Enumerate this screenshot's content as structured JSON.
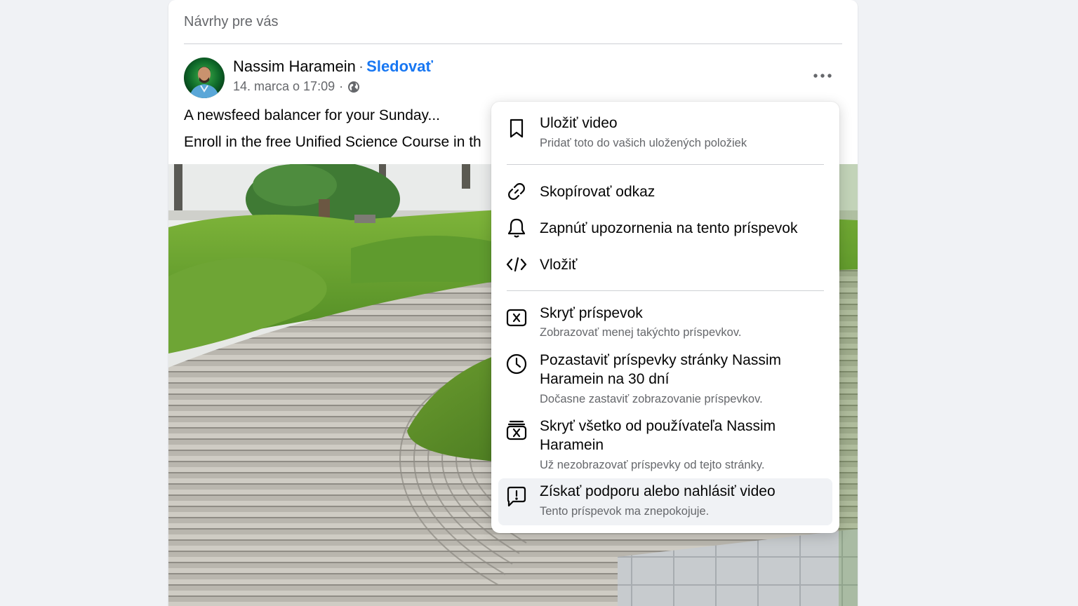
{
  "feed": {
    "section_title": "Návrhy pre vás"
  },
  "post": {
    "author_name": "Nassim Haramein",
    "separator": "·",
    "follow_label": "Sledovať",
    "timestamp": "14. marca o 17:09",
    "meta_separator": "·",
    "privacy_icon": "globe-icon",
    "line1": "A newsfeed balancer for your Sunday...",
    "line2": "Enroll in the free Unified Science Course in th",
    "more_icon": "more-horizontal-icon"
  },
  "menu": {
    "items": [
      {
        "icon": "bookmark-icon",
        "title": "Uložiť video",
        "subtitle": "Pridať toto do vašich uložených položiek"
      },
      {
        "icon": "link-icon",
        "title": "Skopírovať odkaz",
        "subtitle": ""
      },
      {
        "icon": "bell-icon",
        "title": "Zapnúť upozornenia na tento príspevok",
        "subtitle": ""
      },
      {
        "icon": "code-icon",
        "title": "Vložiť",
        "subtitle": ""
      },
      {
        "icon": "close-box-icon",
        "title": "Skryť príspevok",
        "subtitle": "Zobrazovať menej takýchto príspevkov."
      },
      {
        "icon": "clock-icon",
        "title": "Pozastaviť príspevky stránky Nassim Haramein na 30 dní",
        "subtitle": "Dočasne zastaviť zobrazovanie príspevkov."
      },
      {
        "icon": "hide-all-icon",
        "title": "Skryť všetko od používateľa Nassim Haramein",
        "subtitle": "Už nezobrazovať príspevky od tejto stránky."
      },
      {
        "icon": "report-icon",
        "title": "Získať podporu alebo nahlásiť video",
        "subtitle": "Tento príspevok ma znepokojuje."
      }
    ]
  },
  "colors": {
    "accent": "#1877f2",
    "background": "#f0f2f5",
    "secondary_text": "#65676b"
  }
}
